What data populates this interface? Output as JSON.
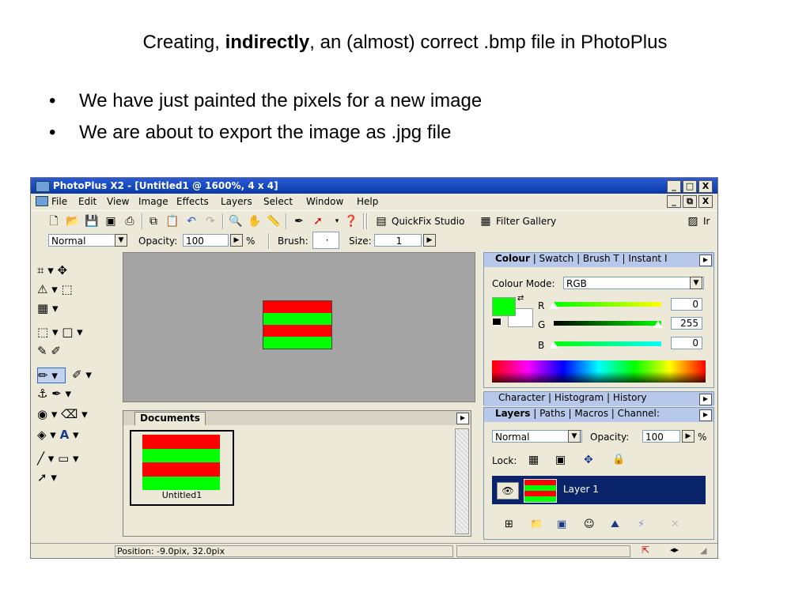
{
  "slide": {
    "title_pre": "Creating, ",
    "title_bold": "indirectly",
    "title_post": ", an (almost) correct .bmp file in  PhotoPlus",
    "bullets": [
      "We have just painted the pixels for a new image",
      "We are about to export the image as .jpg file"
    ]
  },
  "app": {
    "window_title": "PhotoPlus X2 - [Untitled1 @ 1600%, 4 x 4]",
    "window_buttons": [
      "_",
      "□",
      "X"
    ],
    "menus": [
      "File",
      "Edit",
      "View",
      "Image",
      "Effects",
      "Layers",
      "Select",
      "Window",
      "Help"
    ],
    "toolbar": {
      "quickfix_label": "QuickFix Studio",
      "filter_gallery_label": "Filter Gallery",
      "truncated_label": "Ir"
    },
    "context_bar": {
      "blend_mode": "Normal",
      "opacity_label": "Opacity:",
      "opacity_value": "100",
      "percent": "%",
      "brush_label": "Brush:",
      "brush_value": "·",
      "size_label": "Size:",
      "size_value": "1"
    },
    "canvas": {
      "pixel_rows": [
        "#ff0000",
        "#00ff00",
        "#ff0000",
        "#00ff00"
      ]
    },
    "documents": {
      "tab_label": "Documents",
      "thumbnail_name": "Untitled1"
    },
    "status": {
      "position_text": "Position: -9.0pix, 32.0pix"
    },
    "colour_panel": {
      "tabs": [
        "Colour",
        "Swatch",
        "Brush T",
        "Instant I"
      ],
      "mode_label": "Colour Mode:",
      "mode_value": "RGB",
      "r_label": "R",
      "g_label": "G",
      "b_label": "B",
      "r_value": "0",
      "g_value": "255",
      "b_value": "0",
      "foreground_color": "#00ff00"
    },
    "char_panel": {
      "tabs": "Character | Histogram | History"
    },
    "layers_panel": {
      "tabs": [
        "Layers",
        "Paths",
        "Macros",
        "Channel:"
      ],
      "blend_mode": "Normal",
      "opacity_label": "Opacity:",
      "opacity_value": "100",
      "percent": "%",
      "lock_label": "Lock:",
      "layer_name": "Layer 1"
    }
  }
}
